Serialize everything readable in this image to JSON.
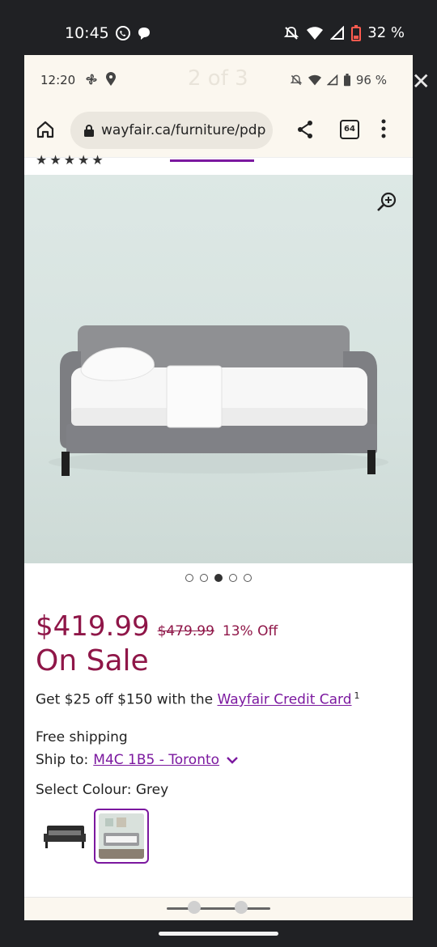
{
  "outer_status": {
    "time": "10:45",
    "battery": "32 %"
  },
  "inner_status": {
    "time": "12:20",
    "counter": "2 of 3",
    "battery": "96 %"
  },
  "browser": {
    "url": "wayfair.ca/furniture/pdp",
    "tab_count": "64"
  },
  "gallery": {
    "dot_count": 5,
    "active_index": 2
  },
  "product": {
    "price": "$419.99",
    "original_price": "$479.99",
    "discount": "13% Off",
    "sale_label": "On Sale",
    "credit_text": "Get $25 off $150 with the ",
    "credit_link": "Wayfair Credit Card",
    "credit_footnote": "1",
    "shipping": "Free shipping",
    "ship_to_label": "Ship to:",
    "ship_to_location": "M4C 1B5 - Toronto",
    "colour_label": "Select Colour: Grey"
  },
  "colors": {
    "brand_purple": "#7b189f",
    "sale_red": "#8f1648"
  }
}
